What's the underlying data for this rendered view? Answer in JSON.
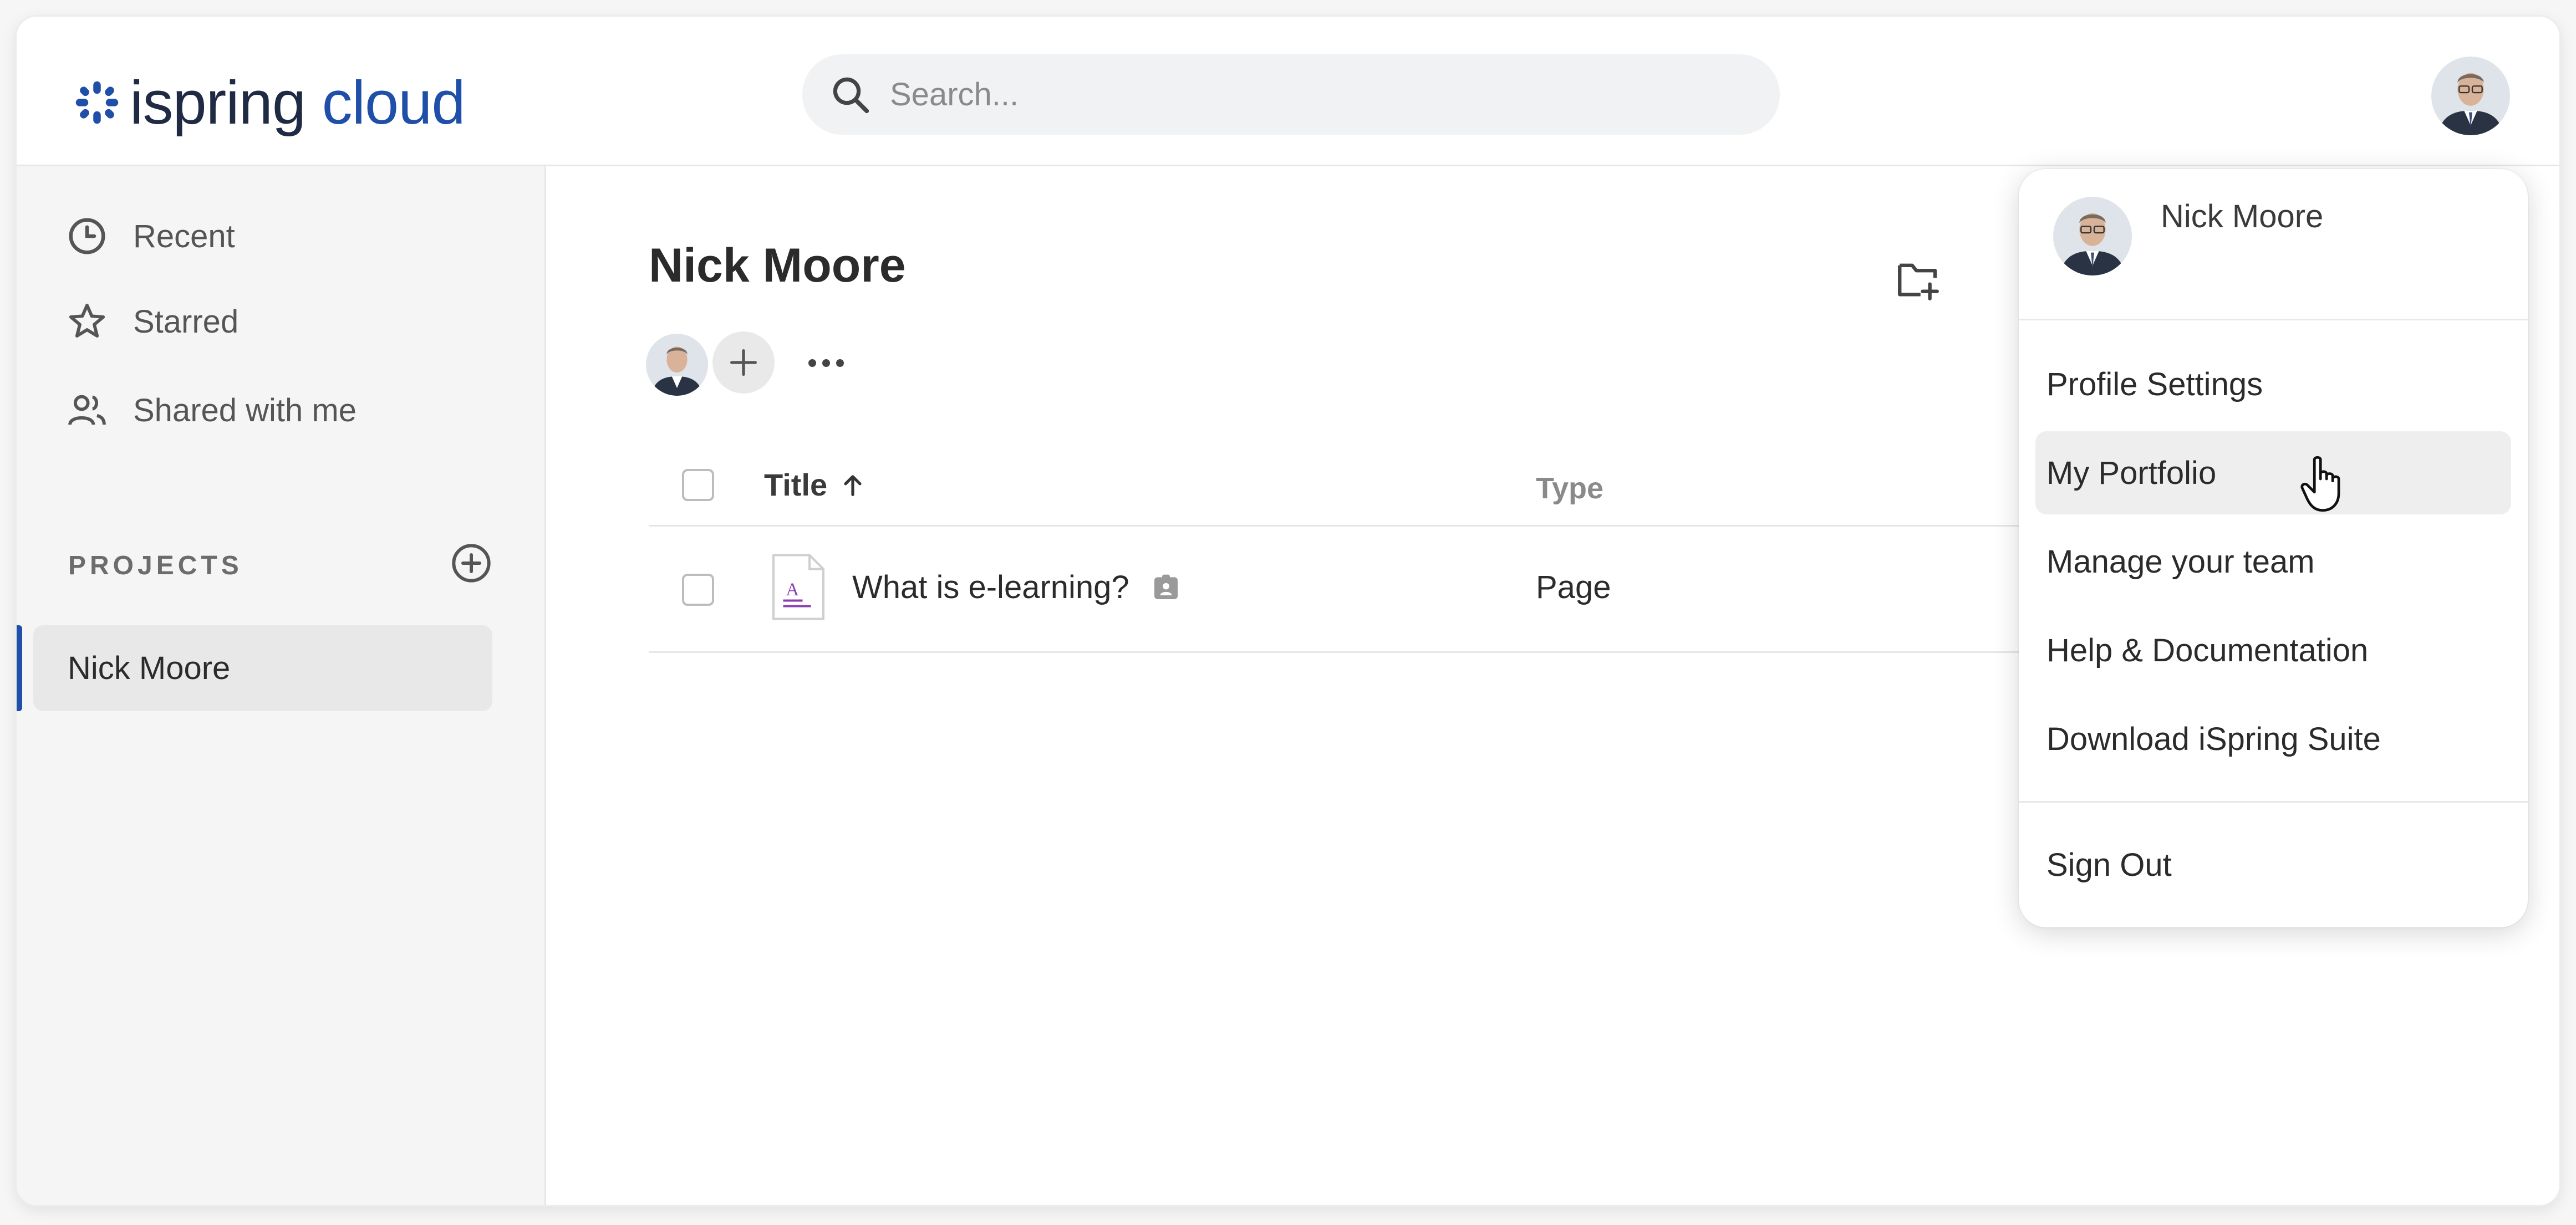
{
  "app": {
    "logo_word1": "ispring",
    "logo_word2": "cloud",
    "brand_color": "#1f4fa8"
  },
  "header": {
    "search_placeholder": "Search...",
    "search_icon": "search-icon",
    "avatar": "user-avatar"
  },
  "sidebar": {
    "items": [
      {
        "label": "Recent",
        "icon": "clock-icon"
      },
      {
        "label": "Starred",
        "icon": "star-icon"
      },
      {
        "label": "Shared with me",
        "icon": "people-icon"
      }
    ],
    "projects_label": "PROJECTS",
    "add_project_icon": "add-circle-icon",
    "projects": [
      {
        "label": "Nick Moore",
        "selected": true
      }
    ]
  },
  "main": {
    "title": "Nick Moore",
    "new_folder_icon": "new-folder-icon",
    "table": {
      "columns": [
        {
          "label": "Title",
          "sort": "ascending"
        },
        {
          "label": "Type"
        }
      ],
      "rows": [
        {
          "title": "What is e-learning?",
          "type": "Page",
          "icon": "page-document-icon",
          "badge": "private-lock-icon"
        }
      ]
    }
  },
  "dropdown": {
    "user_name": "Nick Moore",
    "items": [
      {
        "label": "Profile Settings"
      },
      {
        "label": "My Portfolio",
        "hovered": true
      },
      {
        "label": "Manage your team"
      },
      {
        "label": "Help & Documentation"
      },
      {
        "label": "Download iSpring Suite"
      }
    ],
    "sign_out": "Sign Out"
  }
}
